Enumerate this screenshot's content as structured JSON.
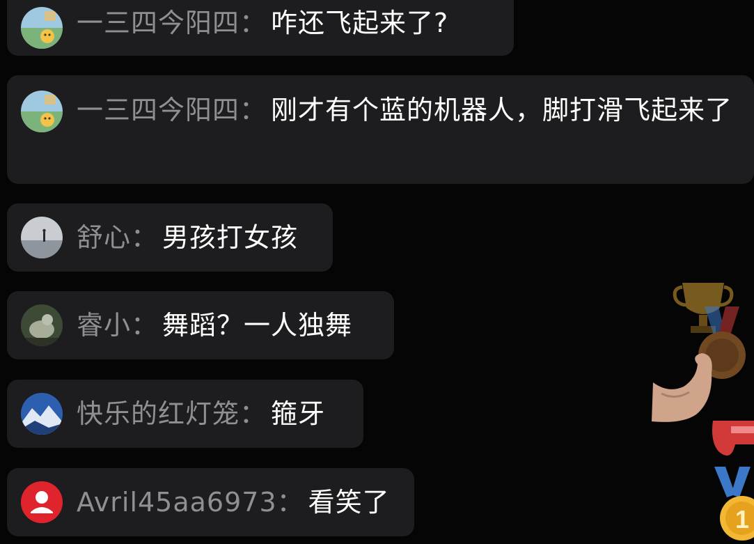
{
  "comments": [
    {
      "user": "一三四今阳四",
      "separator": "：",
      "text": "咋还飞起来了?",
      "avatar": "landscape-cartoon-avatar"
    },
    {
      "user": "一三四今阳四",
      "separator": "：",
      "text": "刚才有个蓝的机器人，脚打滑飞起来了",
      "avatar": "landscape-cartoon-avatar"
    },
    {
      "user": "舒心",
      "separator": "：",
      "text": "男孩打女孩",
      "avatar": "misty-lake-avatar"
    },
    {
      "user": "睿小",
      "separator": "：",
      "text": "舞蹈？一人独舞",
      "avatar": "animal-avatar"
    },
    {
      "user": "快乐的红灯笼",
      "separator": "：",
      "text": "箍牙",
      "avatar": "mountain-avatar"
    },
    {
      "user": "Avril45aa6973",
      "separator": "：",
      "text": "看笑了",
      "avatar": "default-user-avatar"
    }
  ],
  "decorations": [
    "trophy-icon",
    "medal-icon",
    "flexed-biceps-icon",
    "whistle-icon",
    "gold-medal-icon"
  ],
  "colors": {
    "bubble": "#1d1d1f",
    "username": "#8f8f94",
    "text": "#ffffff",
    "background": "#050505"
  }
}
